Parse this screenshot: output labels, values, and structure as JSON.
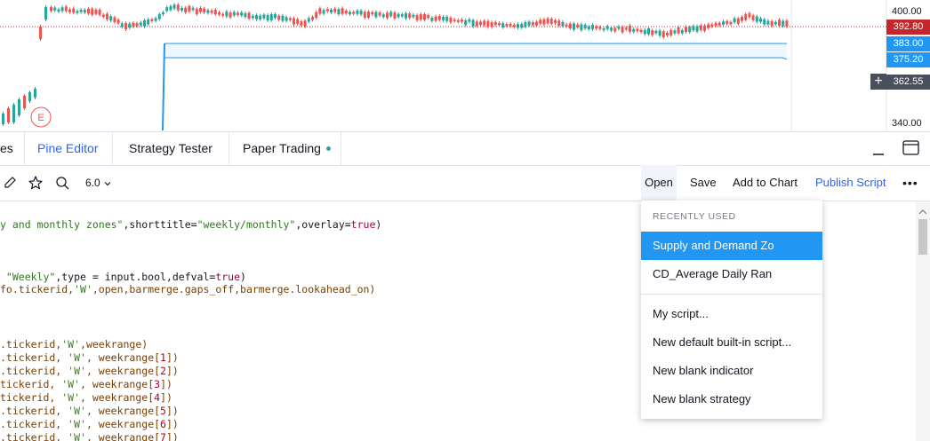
{
  "chart": {
    "price_axis": {
      "top_label": "400.00",
      "current_price": "392.80",
      "zone_top": "383.00",
      "zone_bottom": "375.20",
      "crosshair_price": "362.55",
      "bottom_label": "340.00"
    },
    "marker_letter": "E",
    "crosshair_icon": "plus-icon",
    "colors": {
      "up": "#26a69a",
      "down": "#ef5350",
      "zone": "#2196f3",
      "current_price_bg": "#c2272d"
    }
  },
  "tabs": {
    "items": [
      {
        "label": "es"
      },
      {
        "label": "Pine Editor",
        "active": true
      },
      {
        "label": "Strategy Tester"
      },
      {
        "label": "Paper Trading"
      }
    ],
    "minimize_icon": "minimize-icon",
    "maximize_icon": "maximize-icon"
  },
  "toolbar": {
    "version": "6.0",
    "open_label": "Open",
    "save_label": "Save",
    "add_label": "Add to Chart",
    "publish_label": "Publish Script",
    "more_icon": "more-horizontal-icon",
    "pencil_icon": "pencil-icon",
    "star_icon": "star-icon",
    "search_icon": "search-icon"
  },
  "code": {
    "line1_a": "y and monthly zones\"",
    "line1_b": ",shorttitle=",
    "line1_c": "\"weekly/monthly\"",
    "line1_d": ",overlay=",
    "line1_e": "true",
    "line1_f": ")",
    "line2_a": " \"Weekly\"",
    "line2_b": ",type = input.bool,defval=",
    "line2_c": "true",
    "line2_d": ")",
    "line3_a": "fo.tickerid,",
    "line3_b": "'W'",
    "line3_c": ",open,barmerge.gaps_off,barmerge.lookahead_on)",
    "lines": [
      {
        "a": ".tickerid,",
        "b": "'W'",
        "c": ",weekrange)",
        "n": ""
      },
      {
        "a": ".tickerid, ",
        "b": "'W'",
        "c": ", weekrange[",
        "n": "1",
        "e": "])"
      },
      {
        "a": ".tickerid, ",
        "b": "'W'",
        "c": ", weekrange[",
        "n": "2",
        "e": "])"
      },
      {
        "a": "tickerid, ",
        "b": "'W'",
        "c": ", weekrange[",
        "n": "3",
        "e": "])"
      },
      {
        "a": "tickerid, ",
        "b": "'W'",
        "c": ", weekrange[",
        "n": "4",
        "e": "])"
      },
      {
        "a": ".tickerid, ",
        "b": "'W'",
        "c": ", weekrange[",
        "n": "5",
        "e": "])"
      },
      {
        "a": ".tickerid, ",
        "b": "'W'",
        "c": ", weekrange[",
        "n": "6",
        "e": "])"
      },
      {
        "a": ".tickerid, ",
        "b": "'W'",
        "c": ", weekrange[",
        "n": "7",
        "e": "])"
      }
    ]
  },
  "dropdown": {
    "header": "RECENTLY USED",
    "recent": [
      "Supply and Demand Zo",
      "CD_Average Daily Ran"
    ],
    "actions": [
      "My script...",
      "New default built-in script...",
      "New blank indicator",
      "New blank strategy"
    ]
  }
}
